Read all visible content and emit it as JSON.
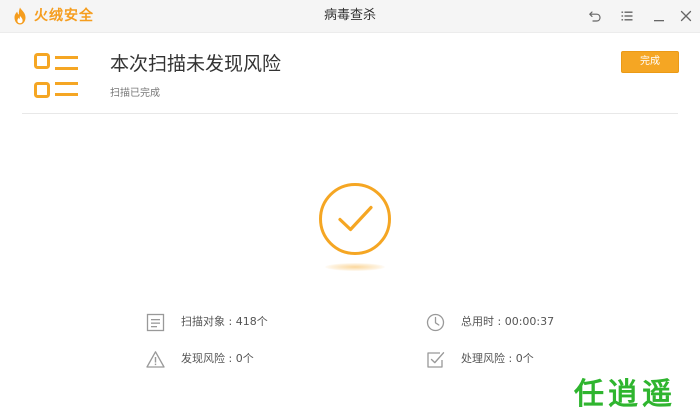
{
  "window": {
    "brand": "火绒安全",
    "title": "病毒查杀"
  },
  "header": {
    "result_title": "本次扫描未发现风险",
    "status": "扫描已完成",
    "done_button": "完成"
  },
  "stats": {
    "scan_objects": "扫描对象 : 418个",
    "total_time": "总用时 : 00:00:37",
    "risks_found": "发现风险 : 0个",
    "risks_handled": "处理风险 : 0个"
  },
  "watermark": {
    "text": "任逍遥"
  },
  "icons": {
    "brand": "flame-logo-icon",
    "back": "back-arrow-icon",
    "menu": "menu-icon",
    "minimize": "minimize-icon",
    "close": "close-icon",
    "header": "report-list-icon",
    "success": "check-circle-icon",
    "scan_objects": "document-icon",
    "total_time": "clock-icon",
    "risks_found": "warning-icon",
    "risks_handled": "checkbox-icon"
  },
  "colors": {
    "accent": "#f5a623",
    "brand": "#f59d1e",
    "watermark": "#2fb52f"
  }
}
